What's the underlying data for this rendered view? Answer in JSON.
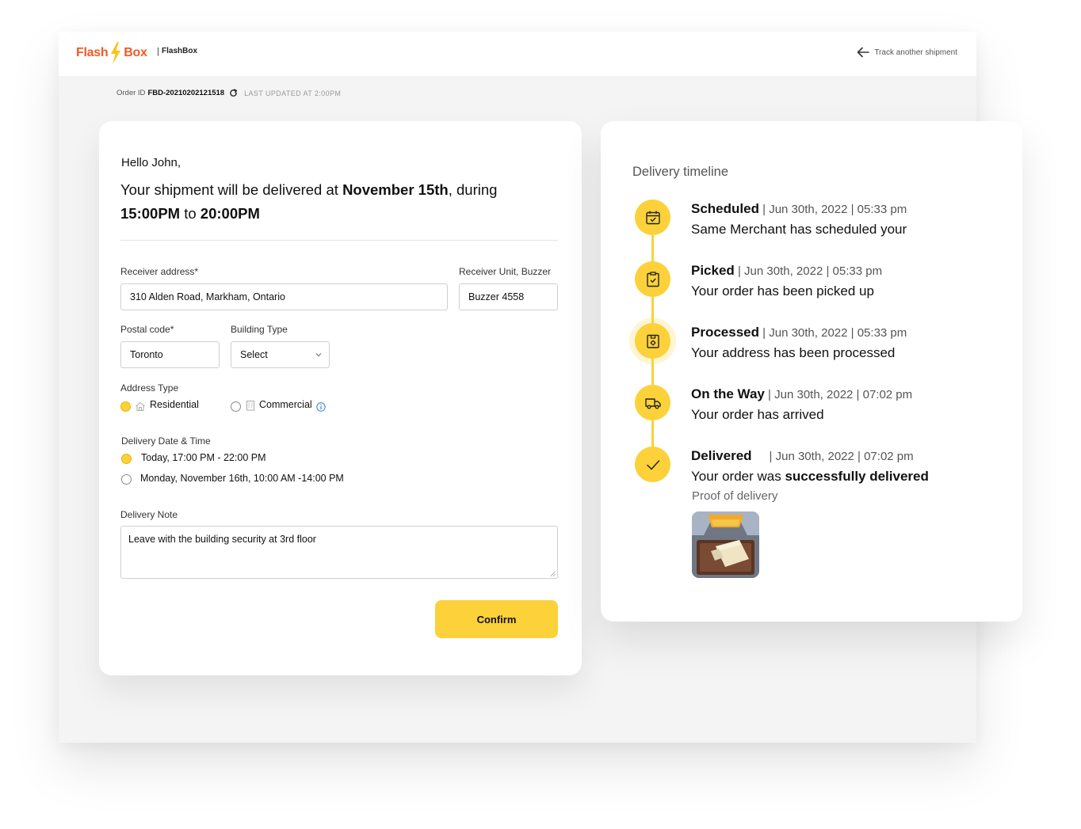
{
  "header": {
    "brand_flash": "Flash",
    "brand_box": "Box",
    "brand_sep": "|",
    "brand_name": "FlashBox",
    "track_link": "Track another shipment"
  },
  "order": {
    "id_label": "Order ID",
    "id_value": "FBD-20210202121518",
    "last_updated": "LAST UPDATED AT 2:00PM"
  },
  "form": {
    "greeting": "Hello John,",
    "headline_pre": "Your shipment will be delivered at ",
    "headline_date": "November 15th",
    "headline_mid": ", during",
    "headline_from": "15:00PM",
    "headline_to": " to ",
    "headline_until": "20:00PM",
    "receiver_address_label": "Receiver address*",
    "receiver_address_value": "310 Alden Road, Markham, Ontario",
    "receiver_unit_label": "Receiver Unit, Buzzer",
    "receiver_unit_value": "Buzzer 4558",
    "postal_code_label": "Postal code*",
    "postal_code_value": "Toronto",
    "building_type_label": "Building Type",
    "building_type_value": "Select",
    "address_type_label": "Address Type",
    "address_types": [
      {
        "label": "Residential",
        "selected": true
      },
      {
        "label": "Commercial",
        "selected": false
      }
    ],
    "delivery_label": "Delivery Date & Time",
    "delivery_options": [
      {
        "label": "Today, 17:00 PM - 22:00 PM",
        "selected": true
      },
      {
        "label": "Monday, November 16th, 10:00 AM -14:00 PM",
        "selected": false
      }
    ],
    "note_label": "Delivery Note",
    "note_value": "Leave with the building security at 3rd floor",
    "confirm_label": "Confirm"
  },
  "timeline": {
    "title": "Delivery timeline",
    "steps": [
      {
        "status": "Scheduled",
        "stamp": " | Jun 30th, 2022 | 05:33 pm",
        "desc": "Same Merchant has scheduled your",
        "icon": "calendar-check-icon"
      },
      {
        "status": "Picked",
        "stamp": " | Jun 30th, 2022 | 05:33 pm",
        "desc": "Your order has been picked up",
        "icon": "clipboard-check-icon"
      },
      {
        "status": "Processed",
        "stamp": " | Jun 30th, 2022 | 05:33 pm",
        "desc": "Your address has been processed",
        "icon": "box-gear-icon"
      },
      {
        "status": "On the Way",
        "stamp": " | Jun 30th, 2022 | 07:02 pm",
        "desc": "Your order has arrived",
        "icon": "truck-icon"
      },
      {
        "status": "Delivered",
        "stamp": "| Jun 30th, 2022 | 07:02 pm",
        "desc_pre": "Your order was ",
        "desc_bold": "successfully delivered",
        "icon": "checkmark-icon"
      }
    ],
    "proof_label": "Proof of delivery"
  },
  "colors": {
    "accent": "#fcd13a",
    "brand": "#f05a28",
    "background": "#f4f4f4"
  }
}
